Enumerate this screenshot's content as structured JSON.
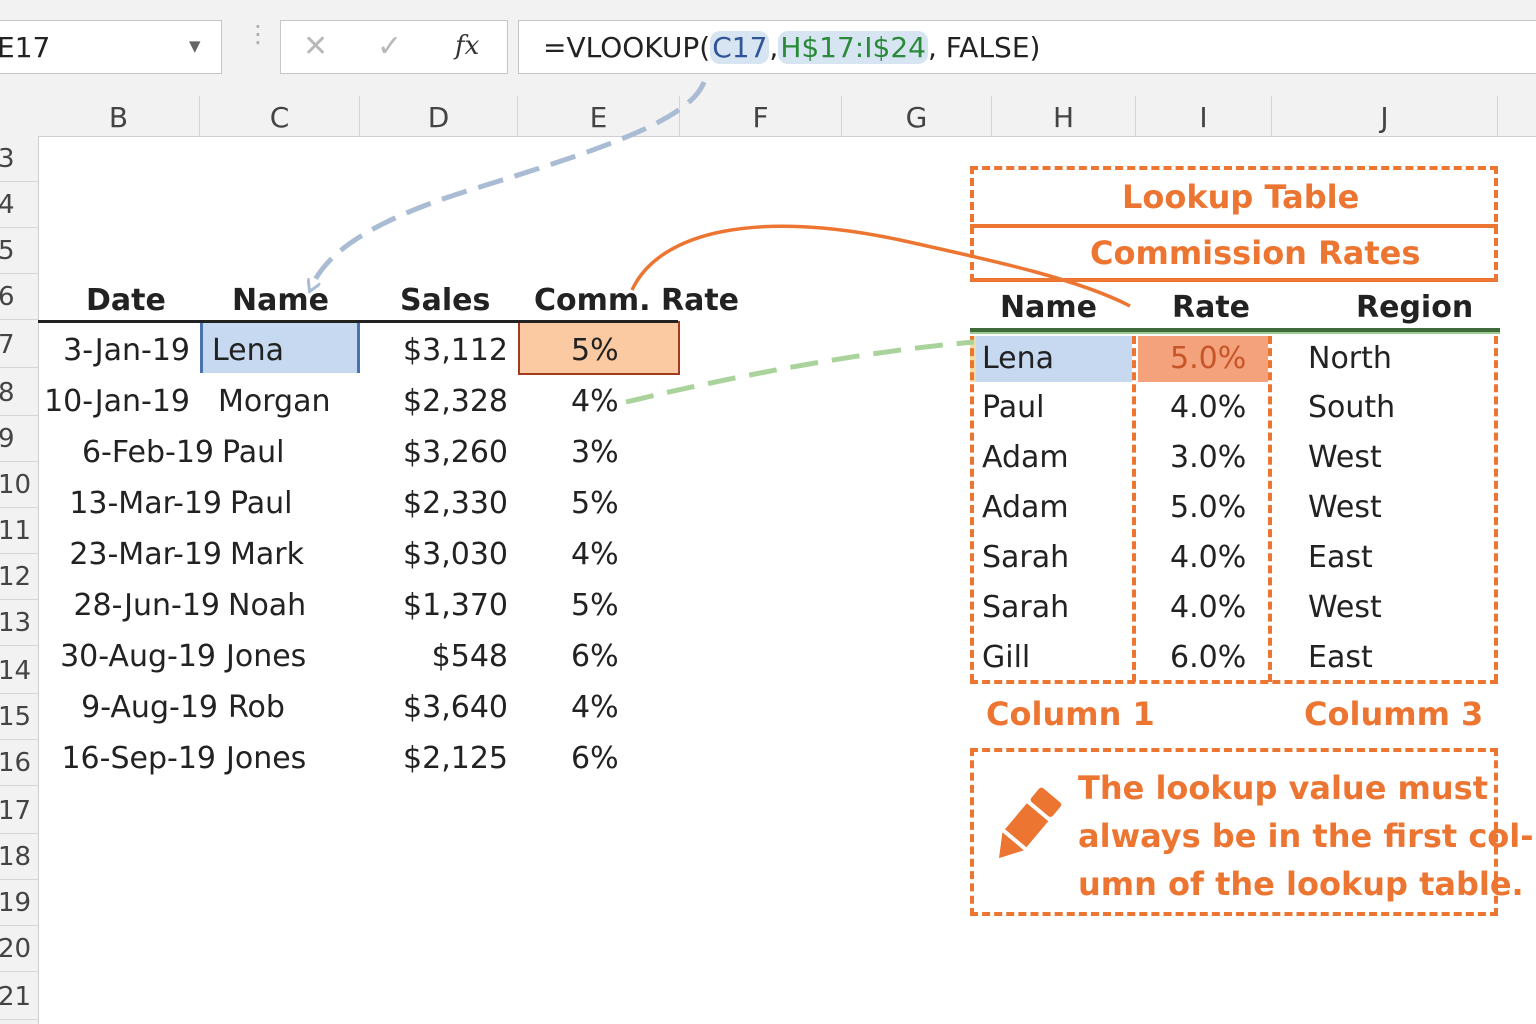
{
  "formula_bar": {
    "name_box": "E17",
    "fx_label": "fx",
    "formula_prefix": "=VLOOKUP(",
    "formula_lookup_ref": "C17",
    "formula_sep1": ",",
    "formula_table_ref": "H$17:I$24",
    "formula_suffix": ", FALSE)"
  },
  "columns": [
    "B",
    "C",
    "D",
    "E",
    "F",
    "G",
    "H",
    "I",
    "J"
  ],
  "rows": [
    "3",
    "4",
    "5",
    "6",
    "7",
    "8",
    "9",
    "10",
    "11",
    "12",
    "13",
    "14",
    "15",
    "16",
    "17",
    "18",
    "19",
    "20",
    "21"
  ],
  "main_table": {
    "headers": [
      "Date",
      "Name",
      "Sales",
      "Comm. Rate"
    ],
    "rows": [
      {
        "date": "3-Jan-19",
        "name": "Lena",
        "sales": "$3,112",
        "rate": "5%"
      },
      {
        "date": "10-Jan-19",
        "name": "Morgan",
        "sales": "$2,328",
        "rate": "4%"
      },
      {
        "date": "6-Feb-19",
        "name": "Paul",
        "sales": "$3,260",
        "rate": "3%"
      },
      {
        "date": "13-Mar-19",
        "name": "Paul",
        "sales": "$2,330",
        "rate": "5%"
      },
      {
        "date": "23-Mar-19",
        "name": "Mark",
        "sales": "$3,030",
        "rate": "4%"
      },
      {
        "date": "28-Jun-19",
        "name": "Noah",
        "sales": "$1,370",
        "rate": "5%"
      },
      {
        "date": "30-Aug-19",
        "name": "Jones",
        "sales": "$548",
        "rate": "6%"
      },
      {
        "date": "9-Aug-19",
        "name": "Rob",
        "sales": "$3,640",
        "rate": "4%"
      },
      {
        "date": "16-Sep-19",
        "name": "Jones",
        "sales": "$2,125",
        "rate": "6%"
      }
    ]
  },
  "lookup_table": {
    "title": "Lookup Table",
    "subtitle": "Commission Rates",
    "headers": [
      "Name",
      "Rate",
      "Region"
    ],
    "rows": [
      {
        "name": "Lena",
        "rate": "5.0%",
        "region": "North"
      },
      {
        "name": "Paul",
        "rate": "4.0%",
        "region": "South"
      },
      {
        "name": "Adam",
        "rate": "3.0%",
        "region": "West"
      },
      {
        "name": "Adam",
        "rate": "5.0%",
        "region": "West"
      },
      {
        "name": "Sarah",
        "rate": "4.0%",
        "region": "East"
      },
      {
        "name": "Sarah",
        "rate": "4.0%",
        "region": "West"
      },
      {
        "name": "Gill",
        "rate": "6.0%",
        "region": "East"
      }
    ],
    "column1_label": "Column 1",
    "column3_label": "Columm 3"
  },
  "note": {
    "line1": "The lookup value must",
    "line2": "always be in the first col-",
    "line3": "umn of the lookup table."
  },
  "colors": {
    "accent_orange": "#ed7532",
    "lookup_blue": "#c6d9f0",
    "result_peach": "#fbc9a2",
    "range_green": "#2a8a3a"
  },
  "icons": {
    "cancel": "close-icon",
    "enter": "check-icon",
    "function": "fx-icon",
    "note": "pencil-icon"
  }
}
